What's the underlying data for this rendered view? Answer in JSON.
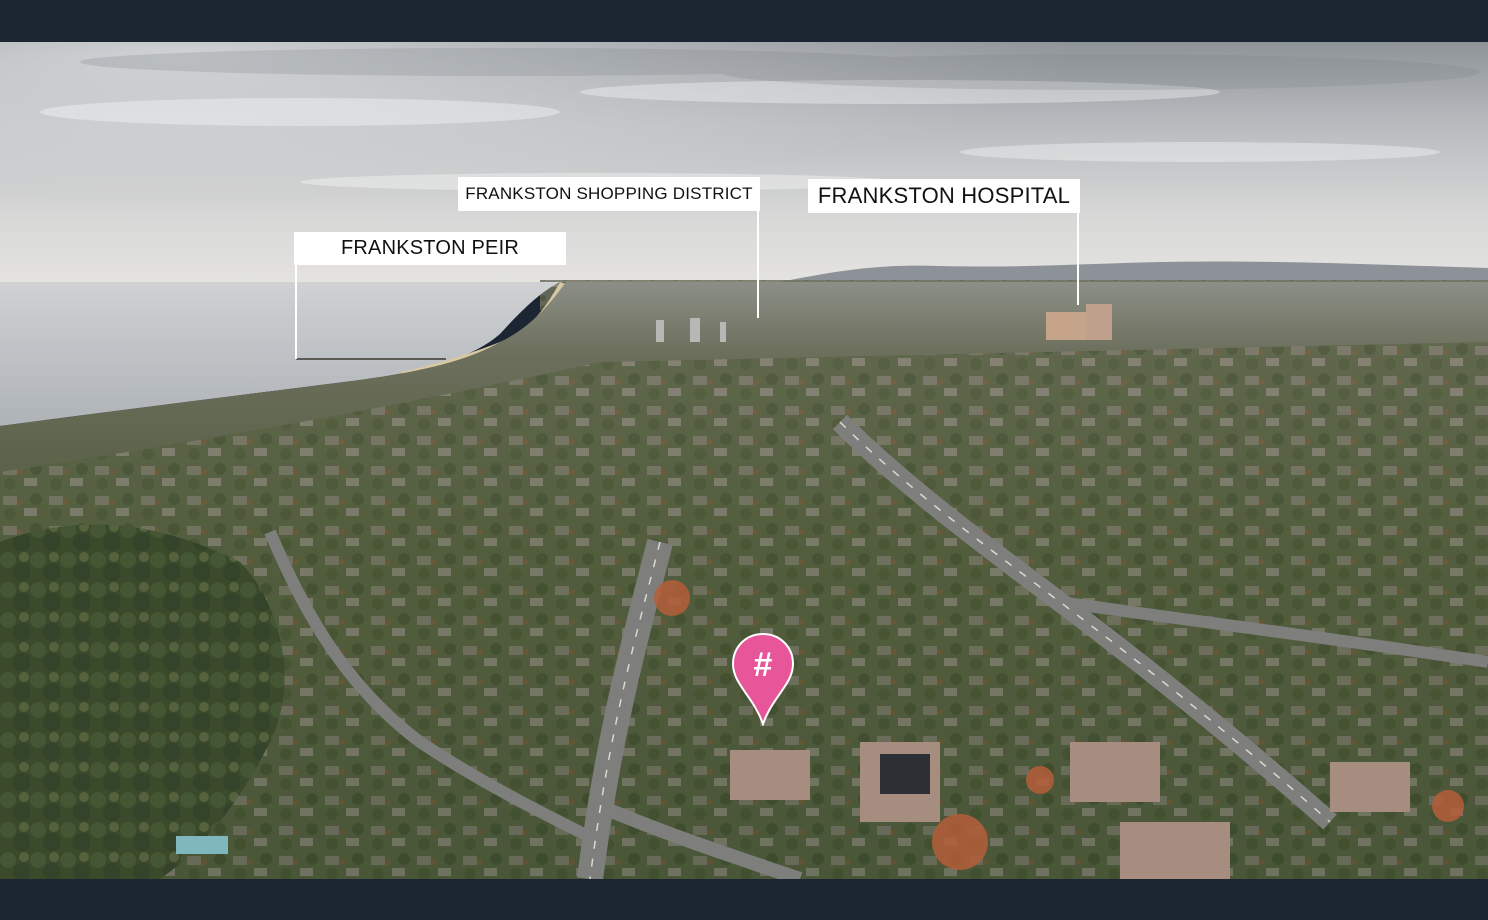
{
  "image": {
    "description_kind": "aerial-photo",
    "frame_color": "#1c2532"
  },
  "labels": {
    "peir": "FRANKSTON PEIR",
    "shopping": "FRANKSTON SHOPPING DISTRICT",
    "hospital": "FRANKSTON HOSPITAL"
  },
  "marker": {
    "icon": "hashtag-location-pin-icon",
    "glyph": "#",
    "color": "#e8569a"
  }
}
